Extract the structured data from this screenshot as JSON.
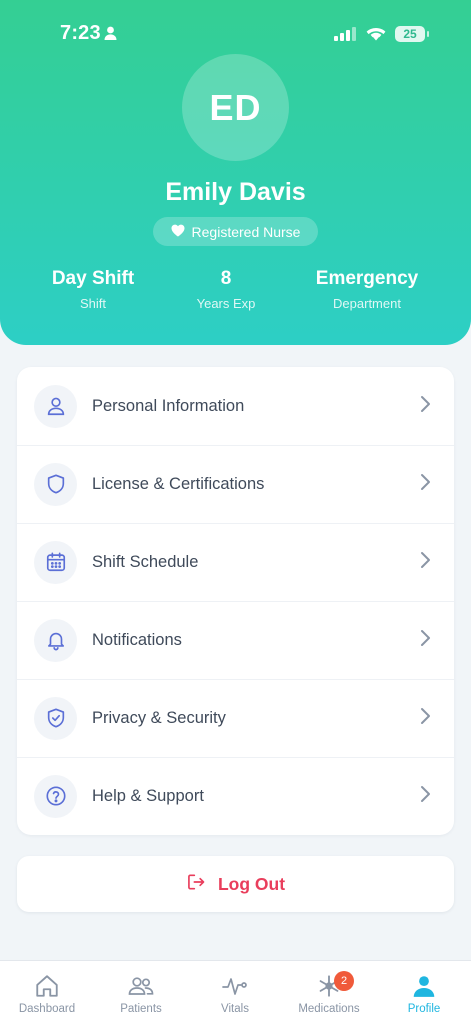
{
  "status_bar": {
    "time": "7:23",
    "battery": "25"
  },
  "profile": {
    "initials": "ED",
    "name": "Emily Davis",
    "role": "Registered Nurse",
    "stats": [
      {
        "value": "Day Shift",
        "label": "Shift"
      },
      {
        "value": "8",
        "label": "Years Exp"
      },
      {
        "value": "Emergency",
        "label": "Department"
      }
    ]
  },
  "menu": {
    "items": [
      {
        "label": "Personal Information",
        "icon": "user-icon"
      },
      {
        "label": "License & Certifications",
        "icon": "shield-icon"
      },
      {
        "label": "Shift Schedule",
        "icon": "calendar-icon"
      },
      {
        "label": "Notifications",
        "icon": "bell-icon"
      },
      {
        "label": "Privacy & Security",
        "icon": "shield-check-icon"
      },
      {
        "label": "Help & Support",
        "icon": "help-circle-icon"
      }
    ]
  },
  "logout": {
    "label": "Log Out"
  },
  "tabbar": {
    "tabs": [
      {
        "label": "Dashboard",
        "icon": "home-icon"
      },
      {
        "label": "Patients",
        "icon": "users-icon"
      },
      {
        "label": "Vitals",
        "icon": "activity-icon"
      },
      {
        "label": "Medications",
        "icon": "medical-icon",
        "badge": "2"
      },
      {
        "label": "Profile",
        "icon": "profile-icon",
        "active": true
      }
    ]
  },
  "colors": {
    "header_start": "#34cf93",
    "header_end": "#2dcfc5",
    "icon_accent": "#5b6fd6",
    "logout": "#e93e5c",
    "active_tab": "#1fb6e0",
    "badge": "#f05a3a"
  }
}
